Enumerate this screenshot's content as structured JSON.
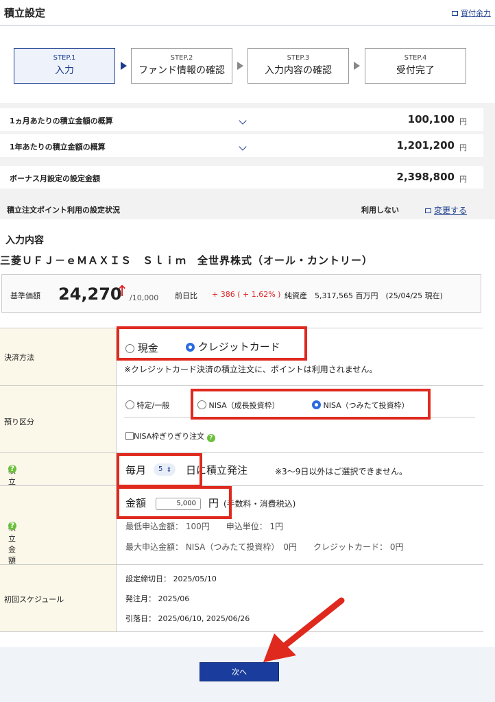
{
  "header": {
    "title": "積立設定",
    "link": "買付余力"
  },
  "steps": [
    {
      "num": "STEP.1",
      "label": "入力"
    },
    {
      "num": "STEP.2",
      "label": "ファンド情報の確認"
    },
    {
      "num": "STEP.3",
      "label": "入力内容の確認"
    },
    {
      "num": "STEP.4",
      "label": "受付完了"
    }
  ],
  "summary": {
    "monthly": {
      "label": "1ヵ月あたりの積立金額の概算",
      "value": "100,100",
      "unit": "円"
    },
    "yearly": {
      "label": "1年あたりの積立金額の概算",
      "value": "1,201,200",
      "unit": "円"
    },
    "bonus": {
      "label": "ボーナス月設定の設定金額",
      "value": "2,398,800",
      "unit": "円"
    },
    "points": {
      "label": "積立注文ポイント利用の設定状況",
      "status": "利用しない",
      "link": "変更する"
    }
  },
  "input": {
    "section_title": "入力内容",
    "fund_name": "三菱ＵＦＪ－ｅＭＡＸＩＳ　Ｓｌｉｍ　全世界株式（オール・カントリー）"
  },
  "price": {
    "label": "基準価額",
    "value": "24,270",
    "arrow": "↑",
    "per": "/10,000",
    "diff_label": "前日比",
    "diff": "+ 386 ( + 1.62% )",
    "nav": "純資産　5,317,565 百万円　(25/04/25 現在)"
  },
  "form": {
    "payment": {
      "label": "決済方法",
      "opt_cash": "現金",
      "opt_card": "クレジットカード",
      "note": "※クレジットカード決済の積立注文に、ポイントは利用されません。"
    },
    "account": {
      "label": "預り区分",
      "opt_general": "特定/一般",
      "opt_nisa_growth": "NISA（成長投資枠）",
      "opt_nisa_tsumitate": "NISA（つみたて投資枠）",
      "check_label": "NISA枠ぎりぎり注文"
    },
    "course": {
      "label": "積立コースと申込設定日",
      "monthly": "毎月",
      "day": "5",
      "day_suffix": "日に積立発注",
      "note": "※3〜9日以外はご選択できません。"
    },
    "amount": {
      "label": "積立金額",
      "prefix": "金額",
      "value": "5,000",
      "unit": "円",
      "suffix": "(手数料・消費税込)",
      "min": "最低申込金額： 100円　　申込単位： 1円",
      "max": "最大申込金額： NISA（つみたて投資枠）　0円　　クレジットカード： 0円"
    },
    "schedule": {
      "label": "初回スケジュール",
      "deadline": "設定締切日： 2025/05/10",
      "order_month": "発注月： 2025/06",
      "debit": "引落日： 2025/06/10, 2025/06/26"
    }
  },
  "next_button": "次へ",
  "colors": {
    "brand": "#1a3c8c",
    "button": "#1a3c9c",
    "highlight": "#e0291e",
    "up": "#e02020"
  }
}
